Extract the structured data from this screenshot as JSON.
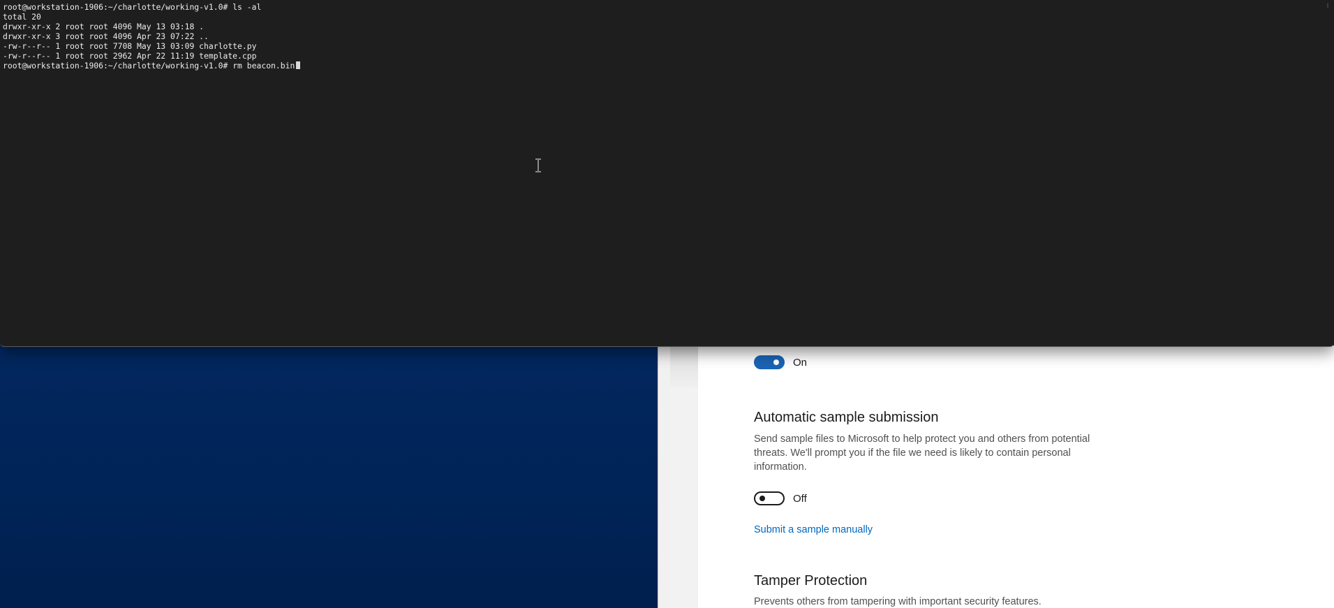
{
  "terminal": {
    "lines": [
      "root@workstation-1906:~/charlotte/working-v1.0# ls -al",
      "total 20",
      "drwxr-xr-x 2 root root 4096 May 13 03:18 .",
      "drwxr-xr-x 3 root root 4096 Apr 23 07:22 ..",
      "-rw-r--r-- 1 root root 7708 May 13 03:09 charlotte.py",
      "-rw-r--r-- 1 root root 2962 Apr 22 11:19 template.cpp"
    ],
    "prompt": "root@workstation-1906:~/charlotte/working-v1.0#",
    "current_input": "rm beacon.bin"
  },
  "settings": {
    "cloud_protection": {
      "toggle_state": "on",
      "toggle_label": "On"
    },
    "automatic_sample_submission": {
      "title": "Automatic sample submission",
      "description": "Send sample files to Microsoft to help protect you and others from potential threats. We'll prompt you if the file we need is likely to contain personal information.",
      "toggle_state": "off",
      "toggle_label": "Off",
      "link": "Submit a sample manually"
    },
    "tamper_protection": {
      "title": "Tamper Protection",
      "description": "Prevents others from tampering with important security features."
    }
  },
  "colors": {
    "terminal_bg": "#1e1e1e",
    "terminal_fg": "#ececec",
    "toggle_on": "#1a64b4",
    "link": "#0067c0",
    "wallpaper": "#002457"
  }
}
